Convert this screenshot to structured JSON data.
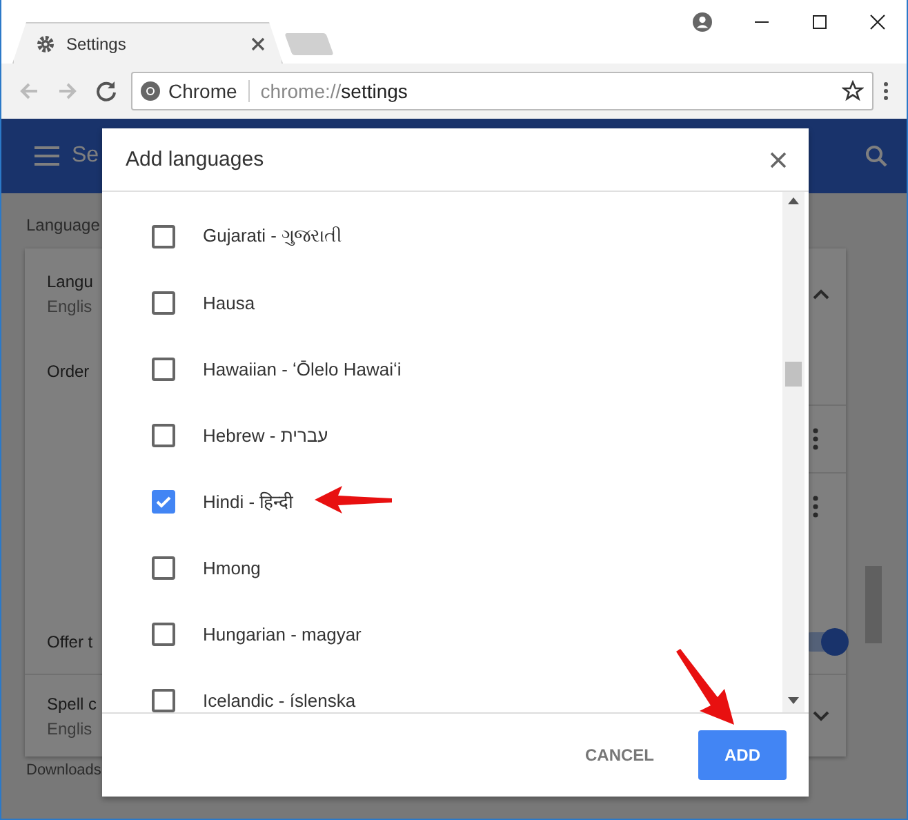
{
  "browser": {
    "tab": {
      "title": "Settings"
    },
    "omnibox": {
      "site_label": "Chrome",
      "url_scheme": "chrome://",
      "url_path": "settings"
    }
  },
  "settings_page": {
    "header_title": "Se",
    "section_heading": "Language",
    "rows": [
      {
        "kind": "expand",
        "title": "Langu",
        "subtitle": "Englis",
        "expanded": true
      },
      {
        "kind": "label",
        "title": "Order"
      },
      {
        "kind": "menu"
      },
      {
        "kind": "menu"
      },
      {
        "kind": "toggle",
        "title": "Offer t",
        "on": true
      },
      {
        "kind": "expand",
        "title": "Spell c",
        "subtitle": "Englis",
        "expanded": false
      }
    ],
    "next_section": "Downloads"
  },
  "dialog": {
    "title": "Add languages",
    "languages": [
      {
        "name": "Gujarati - ગુજરાતી",
        "checked": false
      },
      {
        "name": "Hausa",
        "checked": false
      },
      {
        "name": "Hawaiian - ʻŌlelo Hawaiʻi",
        "checked": false
      },
      {
        "name": "Hebrew - עברית",
        "checked": false
      },
      {
        "name": "Hindi - हिन्दी",
        "checked": true
      },
      {
        "name": "Hmong",
        "checked": false
      },
      {
        "name": "Hungarian - magyar",
        "checked": false
      },
      {
        "name": "Icelandic - íslenska",
        "checked": false
      }
    ],
    "buttons": [
      {
        "label": "CANCEL",
        "kind": "text"
      },
      {
        "label": "ADD",
        "kind": "primary"
      }
    ]
  }
}
